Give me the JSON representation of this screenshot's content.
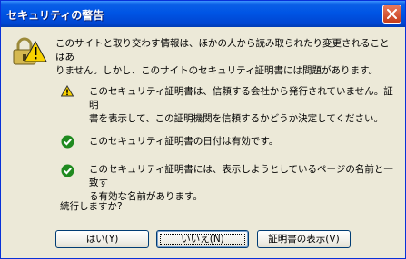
{
  "window": {
    "title": "セキュリティの警告"
  },
  "message": {
    "line1": "このサイトと取り交わす情報は、ほかの人から読み取られたり変更されることはあ",
    "line2": "りません。しかし、このサイトのセキュリティ証明書には問題があります。"
  },
  "checks": [
    {
      "icon": "warning-icon",
      "line1": "このセキュリティ証明書は、信頼する会社から発行されていません。証明",
      "line2": "書を表示して、この証明機関を信頼するかどうか決定してください。"
    },
    {
      "icon": "check-icon",
      "line1": "このセキュリティ証明書の日付は有効です。",
      "line2": ""
    },
    {
      "icon": "check-icon",
      "line1": "このセキュリティ証明書には、表示しようとしているページの名前と一致す",
      "line2": "る有効な名前があります。"
    }
  ],
  "question": "続行しますか?",
  "buttons": {
    "yes": "はい(Y)",
    "no": "いいえ(N)",
    "view": "証明書の表示(V)"
  },
  "colors": {
    "title_bar": "#0055e5",
    "dialog_bg": "#ece9d8",
    "warning": "#f8d200",
    "check": "#1f8a1f"
  }
}
